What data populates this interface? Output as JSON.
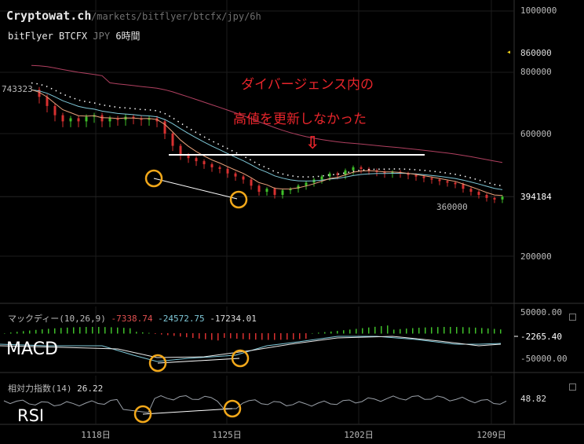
{
  "header": {
    "site_title": "Cryptowat.ch",
    "site_path": "/markets/bitflyer/btcfx/jpy/6h",
    "pair_exchange": "bitFlyer BTCFX",
    "pair_quote": "JPY",
    "pair_interval": "6時間"
  },
  "price_axis": {
    "ticks": [
      "1000000",
      "860000",
      "800000",
      "600000",
      "394184",
      "200000"
    ],
    "current_marker": "◂",
    "high_label": "743323",
    "low_label": "360000"
  },
  "annotation": {
    "line1": "ダイバージェンス内の",
    "line2": "高値を更新しなかった",
    "arrow": "⇩"
  },
  "macd_panel": {
    "title": "マックディー(10,26,9)",
    "v1": "-7338.74",
    "v2": "-24572.75",
    "v3": "-17234.01",
    "ticks": [
      "50000.00",
      "-2265.40",
      "-50000.00"
    ],
    "big_label": "MACD"
  },
  "rsi_panel": {
    "title": "相対力指数(14)",
    "value": "26.22",
    "tick": "48.82",
    "big_label": "RSI"
  },
  "x_axis": {
    "labels": [
      "1118日",
      "1125日",
      "1202日",
      "1209日"
    ]
  },
  "colors": {
    "background": "#000000",
    "up": "#3fbf2a",
    "down": "#d83030",
    "ema_fast": "#e8a07a",
    "ema_slow": "#7fc8d8",
    "ma_long": "#b04060",
    "macd_line": "#7fc8d8",
    "signal_line": "#e8e8e8",
    "rsi_line": "#9aa0a8",
    "circle": "#f2a81a",
    "annotation": "#e8252b",
    "divergence_line": "#ffffff"
  },
  "chart_data": {
    "type": "candlestick",
    "title": "bitFlyer BTCFX JPY 6時間",
    "x_ticks": [
      "1118日",
      "1125日",
      "1202日",
      "1209日"
    ],
    "price_range": [
      0,
      1000000
    ],
    "price_high": 743323,
    "price_low": 360000,
    "last_price": 394184,
    "approx_close": [
      743000,
      720000,
      690000,
      660000,
      640000,
      650000,
      640000,
      655000,
      660000,
      640000,
      650000,
      645000,
      655000,
      650000,
      645000,
      650000,
      640000,
      600000,
      560000,
      530000,
      520000,
      510000,
      500000,
      490000,
      485000,
      470000,
      460000,
      450000,
      430000,
      410000,
      420000,
      400000,
      415000,
      420000,
      430000,
      440000,
      450000,
      460000,
      470000,
      465000,
      480000,
      490000,
      485000,
      480000,
      475000,
      470000,
      475000,
      470000,
      465000,
      460000,
      455000,
      450000,
      445000,
      440000,
      435000,
      420000,
      410000,
      400000,
      390000,
      385000,
      394184
    ],
    "macd": {
      "value": -7338.74,
      "signal": -24572.75,
      "histogram": -17234.01,
      "axis": [
        50000,
        -2265.4,
        -50000
      ]
    },
    "rsi": {
      "period": 14,
      "value": 26.22,
      "reference": 48.82
    }
  }
}
